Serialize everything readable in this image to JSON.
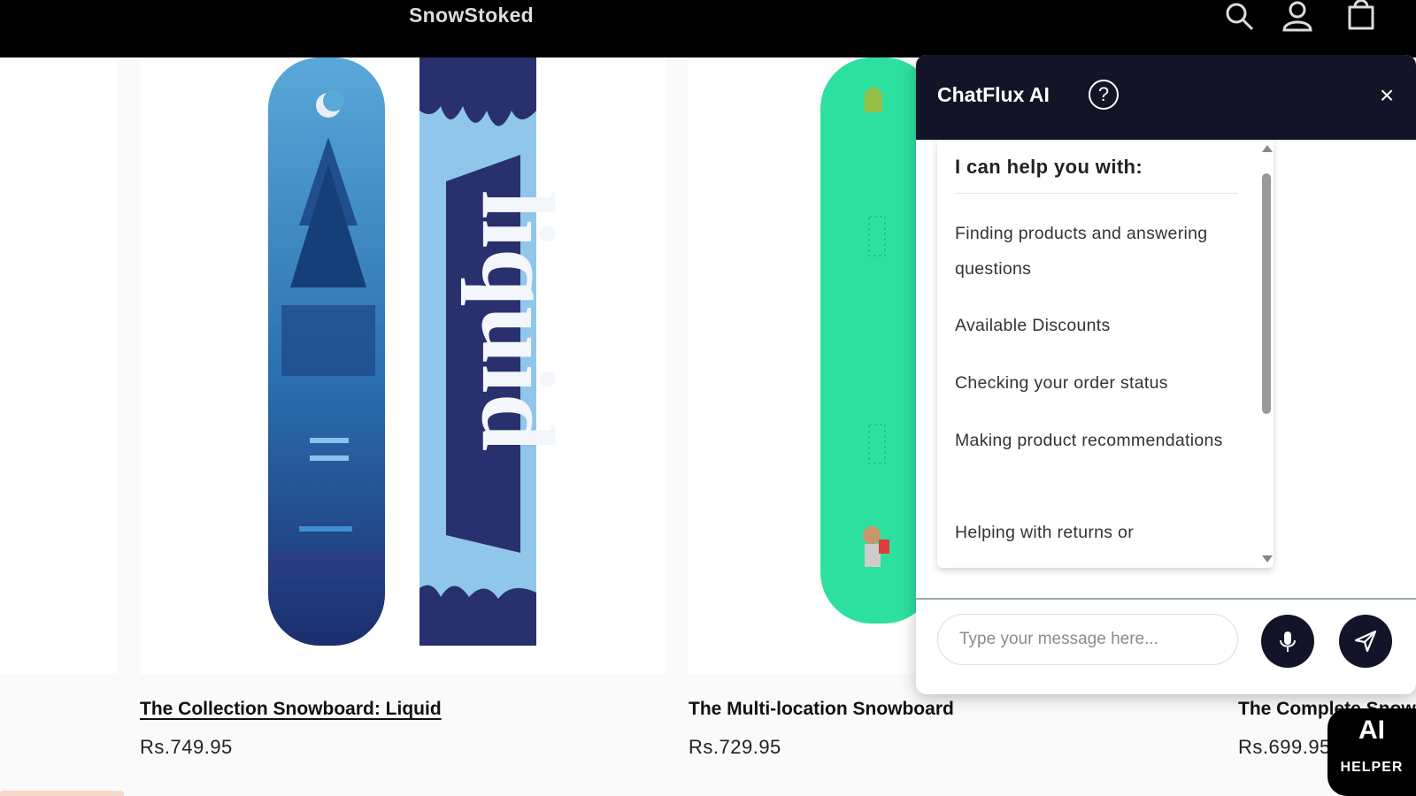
{
  "header": {
    "store_name": "SnowStoked",
    "icons": [
      "search-icon",
      "account-icon",
      "cart-icon"
    ]
  },
  "products": [
    {
      "title": "The Collection Snowboard: Liquid",
      "price": "Rs.749.95"
    },
    {
      "title": "The Multi-location Snowboard",
      "price": "Rs.729.95"
    },
    {
      "title": "The Complete Snowboard",
      "price": "Rs.699.95"
    }
  ],
  "chat": {
    "title": "ChatFlux AI",
    "help_symbol": "?",
    "close_symbol": "×",
    "help_heading": "I can help you with:",
    "help_items": [
      "Finding products and answering questions",
      "Available Discounts",
      "Checking your order status",
      "Making product recommendations",
      "Helping with returns or"
    ],
    "input_placeholder": "Type your message here..."
  },
  "ai_badge": {
    "big": "AI",
    "small": "HELPER"
  },
  "colors": {
    "header_bg": "#000000",
    "chat_header_bg": "#141428",
    "board_green": "#2ee0a0",
    "board_blue": "#2a77b8"
  }
}
